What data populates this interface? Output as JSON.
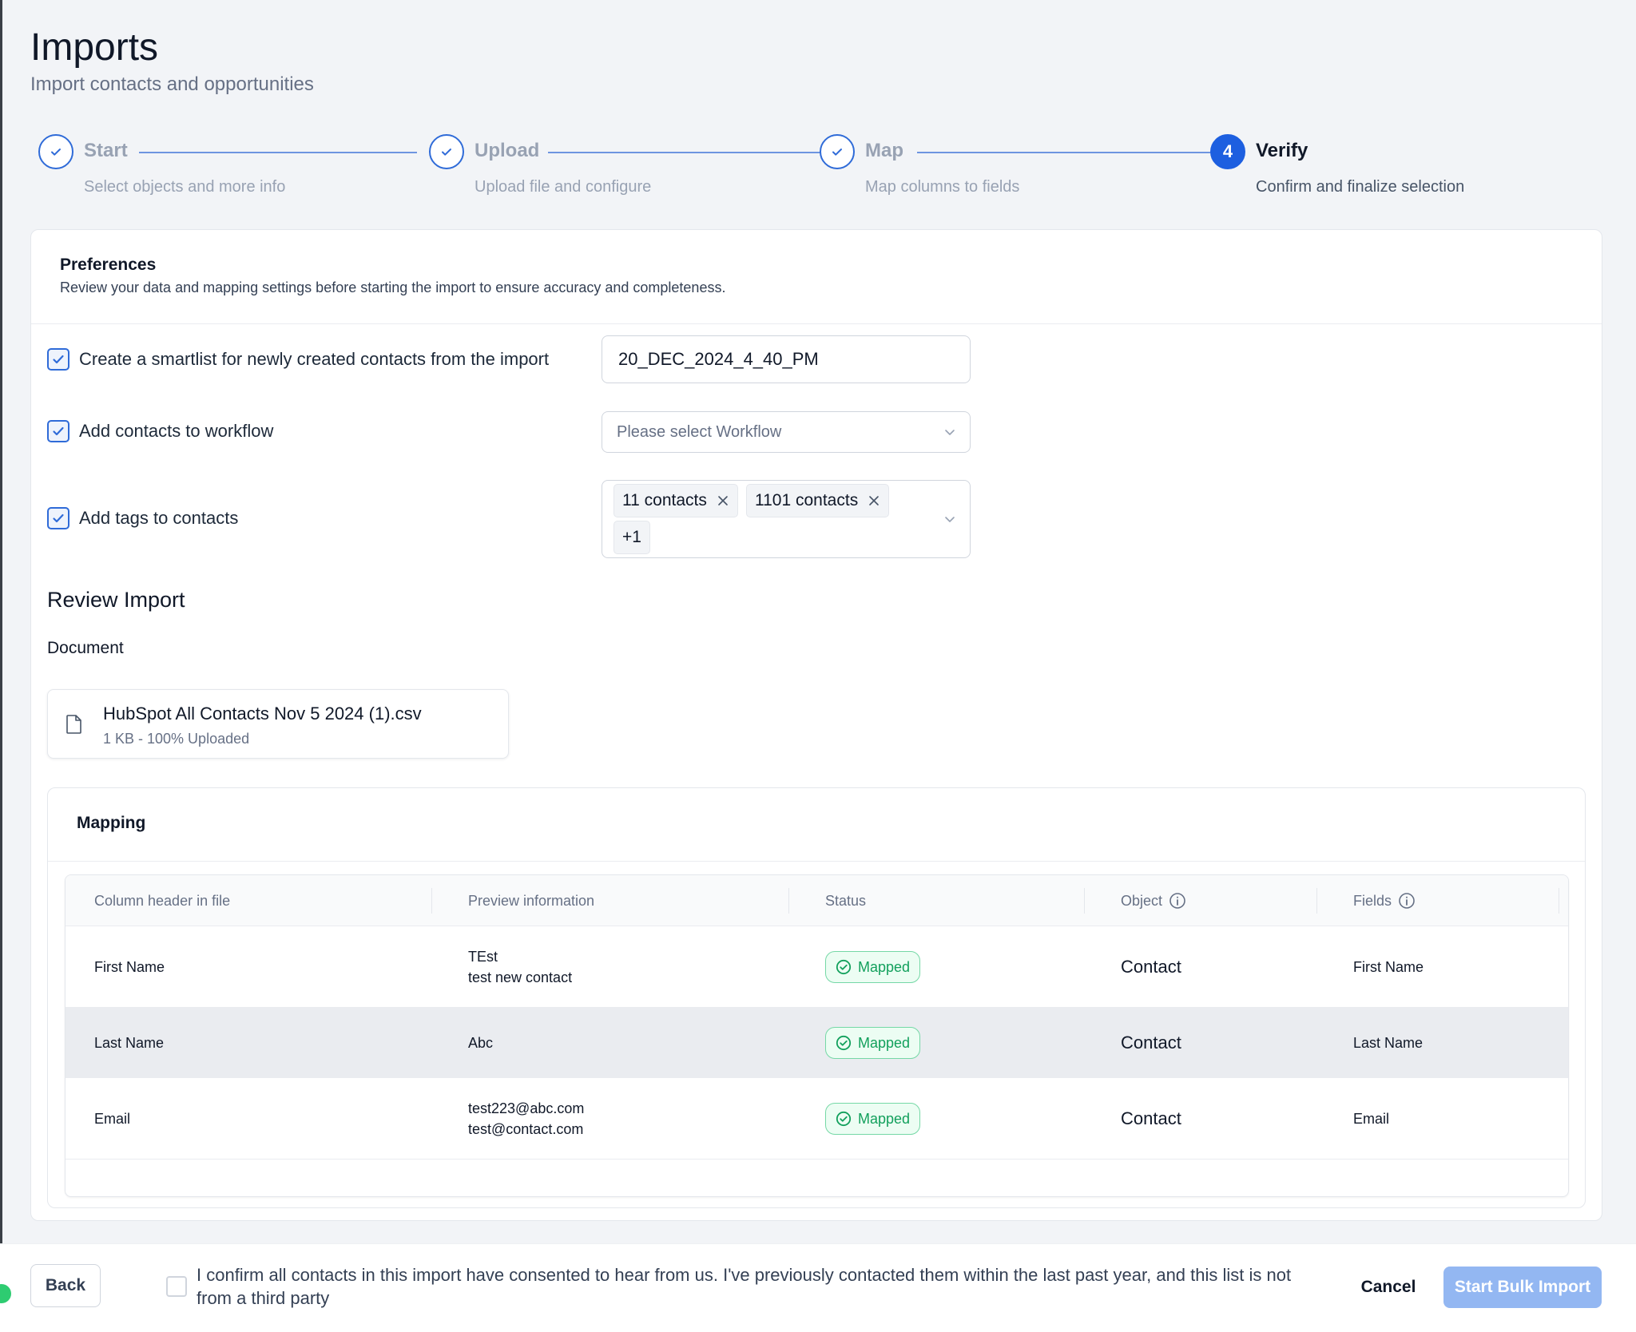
{
  "header": {
    "title": "Imports",
    "subtitle": "Import contacts and opportunities"
  },
  "stepper": {
    "steps": [
      {
        "title": "Start",
        "description": "Select objects and more info",
        "state": "complete"
      },
      {
        "title": "Upload",
        "description": "Upload file and configure",
        "state": "complete"
      },
      {
        "title": "Map",
        "description": "Map columns to fields",
        "state": "complete"
      },
      {
        "title": "Verify",
        "description": "Confirm and finalize selection",
        "state": "active",
        "number": "4"
      }
    ]
  },
  "preferences": {
    "title": "Preferences",
    "description": "Review your data and mapping settings before starting the import to ensure accuracy and completeness.",
    "smartlist": {
      "label": "Create a smartlist for newly created contacts from the import",
      "checked": true,
      "value": "20_DEC_2024_4_40_PM"
    },
    "workflow": {
      "label": "Add contacts to workflow",
      "checked": true,
      "placeholder": "Please select Workflow"
    },
    "tags": {
      "label": "Add tags to contacts",
      "checked": true,
      "items": [
        "11 contacts",
        "1101 contacts"
      ],
      "overflow": "+1"
    }
  },
  "review": {
    "title": "Review Import",
    "document_label": "Document",
    "file": {
      "name": "HubSpot All Contacts Nov 5 2024 (1).csv",
      "meta": "1 KB - 100% Uploaded"
    }
  },
  "mapping": {
    "title": "Mapping",
    "columns": [
      "Column header in file",
      "Preview information",
      "Status",
      "Object",
      "Fields"
    ],
    "rows": [
      {
        "header": "First Name",
        "preview": [
          "TEst",
          "test new contact"
        ],
        "status": "Mapped",
        "object": "Contact",
        "field": "First Name"
      },
      {
        "header": "Last Name",
        "preview": [
          "Abc"
        ],
        "status": "Mapped",
        "object": "Contact",
        "field": "Last Name"
      },
      {
        "header": "Email",
        "preview": [
          "test223@abc.com",
          "test@contact.com"
        ],
        "status": "Mapped",
        "object": "Contact",
        "field": "Email"
      }
    ]
  },
  "footer": {
    "back_label": "Back",
    "consent_text": "I confirm all contacts in this import have consented to hear from us. I've previously contacted them within the last past year, and this list is not from a third party",
    "cancel_label": "Cancel",
    "start_label": "Start Bulk Import"
  },
  "colors": {
    "accent": "#1d5fe0",
    "mapped": "#12a05c",
    "start_disabled": "#93b7f2"
  }
}
